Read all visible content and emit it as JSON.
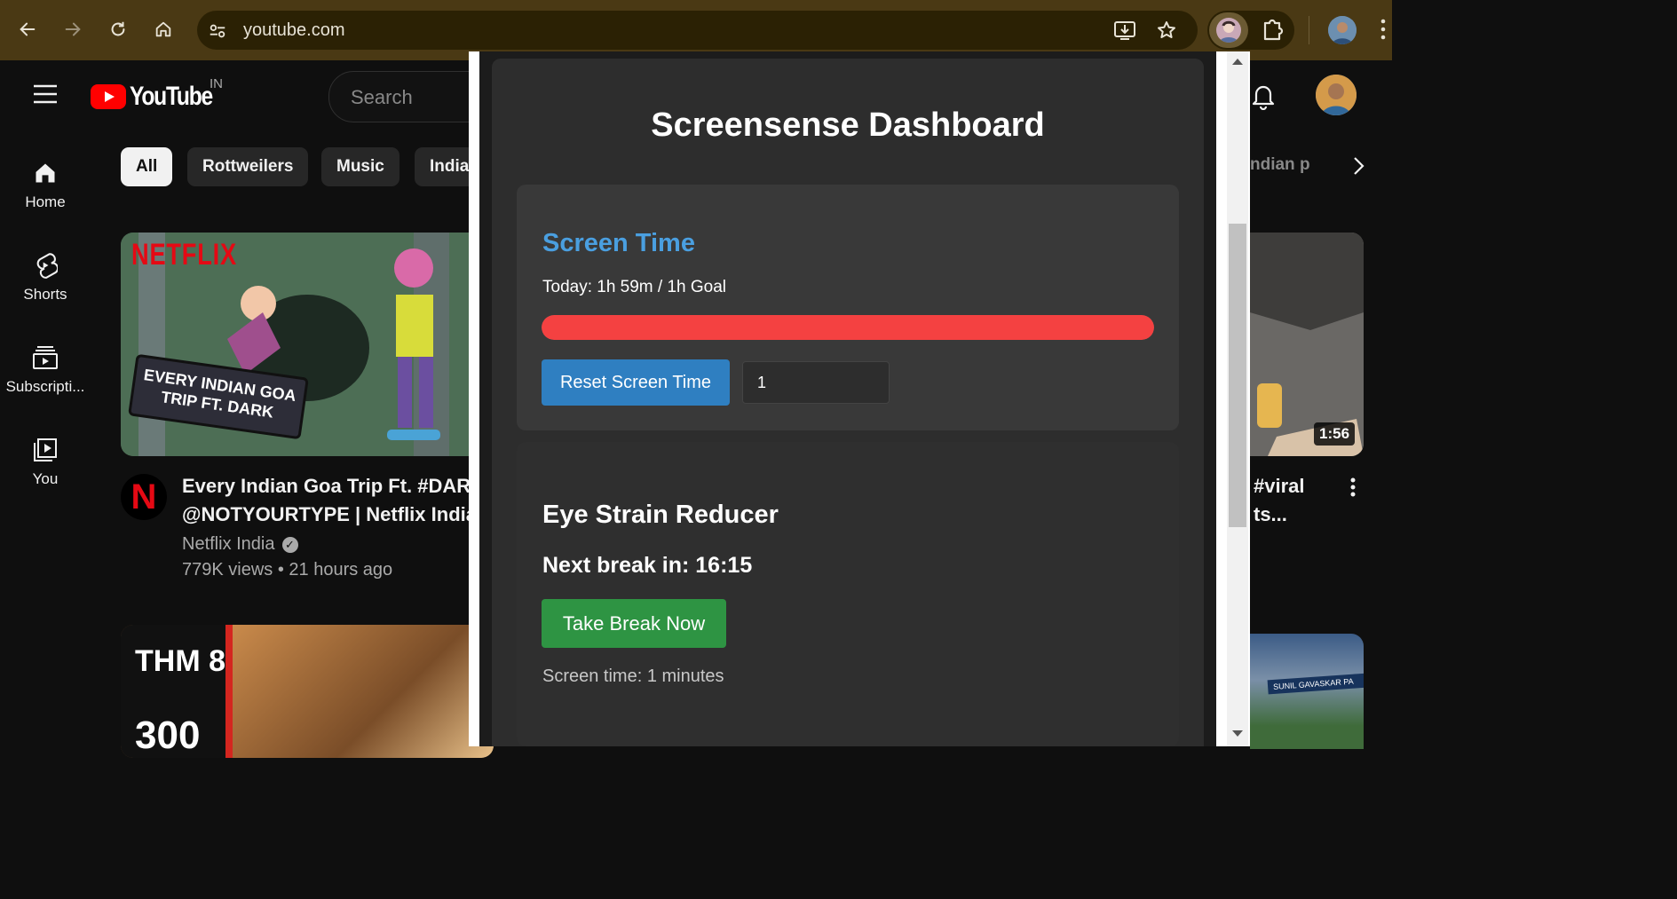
{
  "browser": {
    "url": "youtube.com",
    "icons": [
      "back-icon",
      "forward-icon",
      "reload-icon",
      "home-icon",
      "site-settings-icon",
      "install-icon",
      "star-icon",
      "extension-puzzle-icon",
      "more-icon"
    ]
  },
  "youtube": {
    "logo_text": "YouTube",
    "country": "IN",
    "search_placeholder": "Search",
    "sidebar": [
      {
        "label": "Home",
        "icon": "home-icon"
      },
      {
        "label": "Shorts",
        "icon": "shorts-icon"
      },
      {
        "label": "Subscripti...",
        "icon": "subscriptions-icon"
      },
      {
        "label": "You",
        "icon": "you-icon"
      }
    ],
    "chips": [
      "All",
      "Rottweilers",
      "Music",
      "India"
    ],
    "right_chip": "ndian p",
    "videos": [
      {
        "thumb_brand": "NETFLIX",
        "thumb_sign": "EVERY INDIAN GOA TRIP FT. DARK",
        "title_line1": "Every Indian Goa Trip Ft. #DARK",
        "title_line2": "@NOTYOURTYPE | Netflix India",
        "channel": "Netflix India",
        "meta": "779K views • 21 hours ago"
      },
      {
        "thumb_text1": "THM 8",
        "thumb_text2": "300"
      }
    ],
    "right_video": {
      "duration": "1:56",
      "title_line1": "#viral",
      "title_line2": "ts...",
      "thumb4_banner": "SUNIL GAVASKAR PA"
    }
  },
  "extension": {
    "title": "Screensense Dashboard",
    "screen_time": {
      "heading": "Screen Time",
      "today": "Today: 1h 59m / 1h Goal",
      "progress_fraction": 1.0,
      "reset_label": "Reset Screen Time",
      "goal_input_value": "1"
    },
    "eye_strain": {
      "heading": "Eye Strain Reducer",
      "next_break": "Next break in: 16:15",
      "break_button": "Take Break Now",
      "screen_time_minutes": "Screen time: 1 minutes"
    }
  },
  "colors": {
    "chrome_bg": "#4a3914",
    "yt_bg": "#0f0f0f",
    "accent_blue": "#4a9fe0",
    "progress_red": "#f44141",
    "button_blue": "#2f7fc1",
    "button_green": "#2e9443"
  }
}
